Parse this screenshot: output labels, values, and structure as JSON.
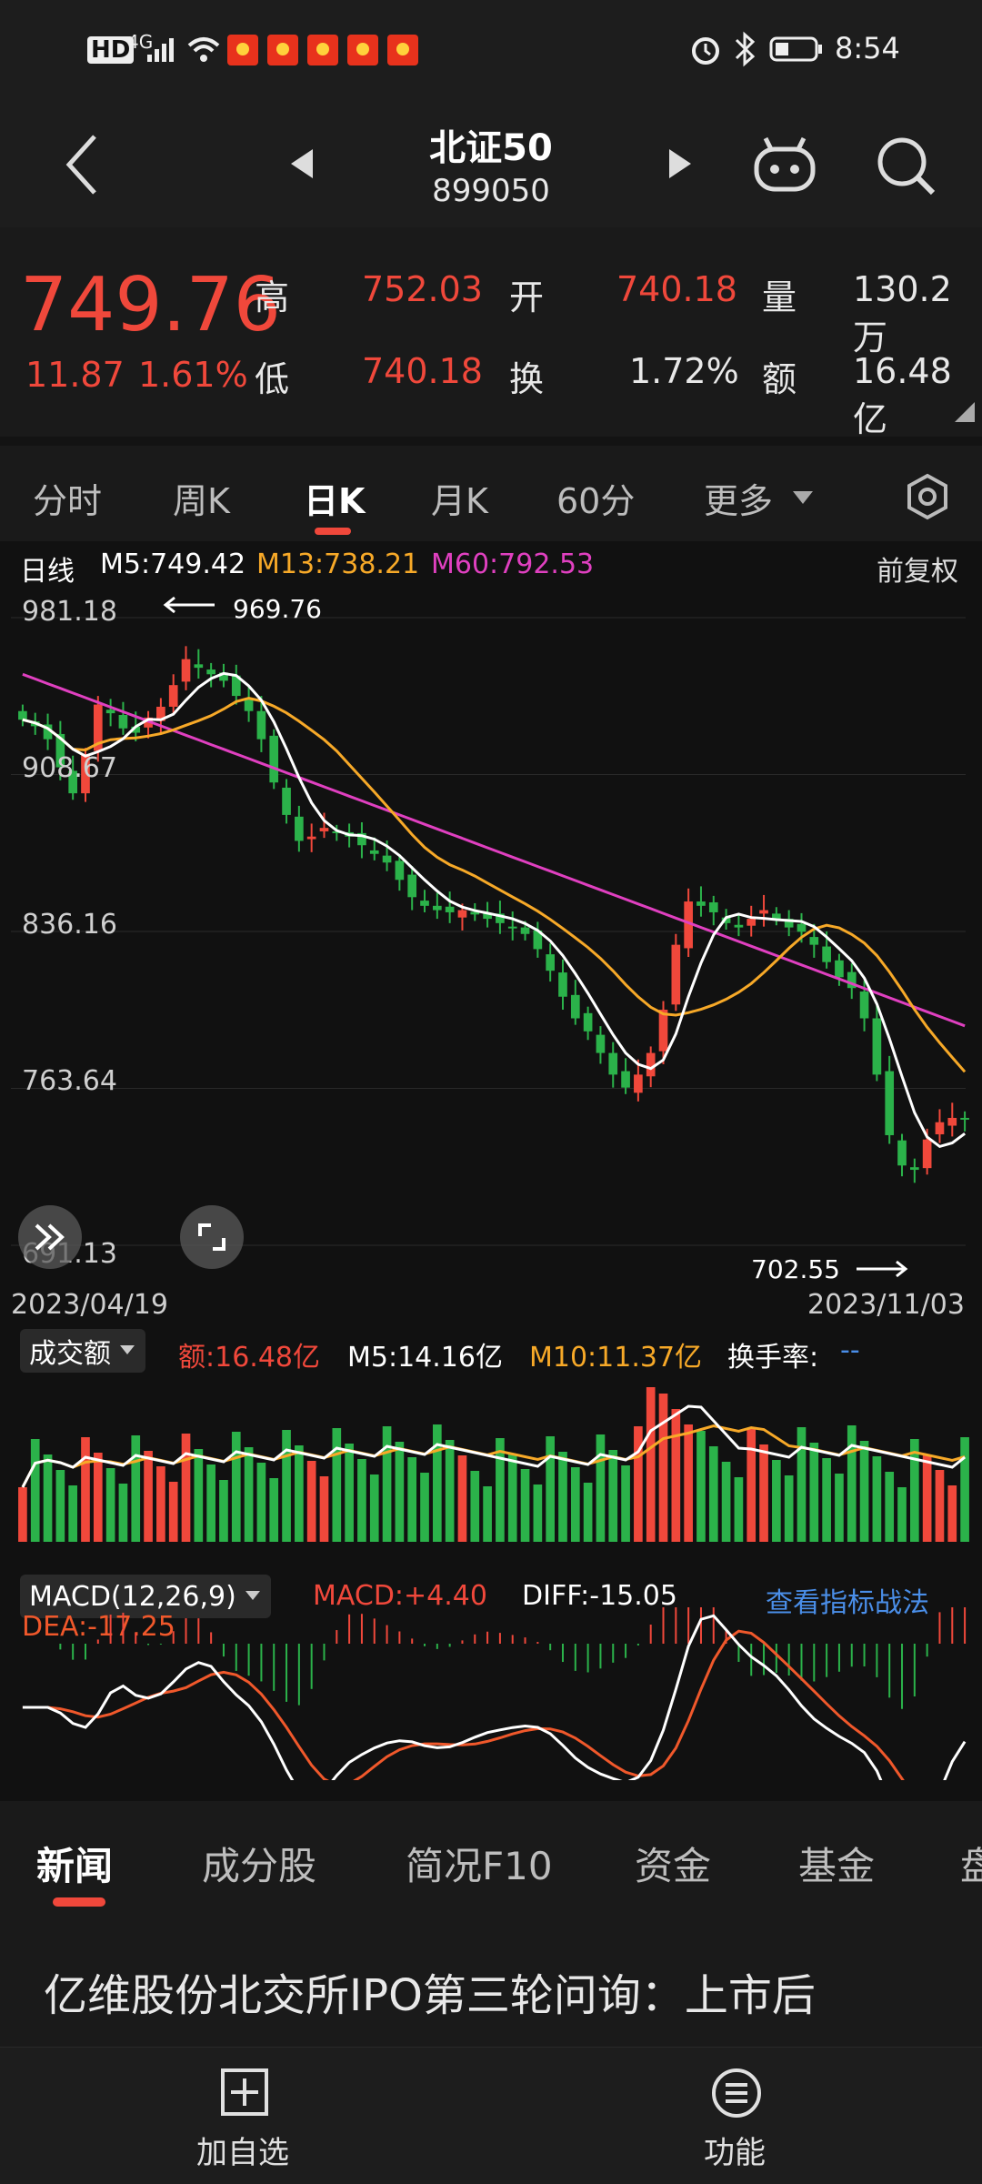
{
  "status_bar": {
    "hd": "HD",
    "net": "4G",
    "time": "8:54",
    "signal_icon": "signal-icon",
    "wifi_icon": "wifi-icon",
    "battery_icon": "battery-icon"
  },
  "header": {
    "title": "北证50",
    "code": "899050"
  },
  "quote": {
    "price": "749.76",
    "change": "11.87",
    "change_pct": "1.61%",
    "high_label": "高",
    "high": "752.03",
    "low_label": "低",
    "low": "740.18",
    "open_label": "开",
    "open": "740.18",
    "turnover_label": "换",
    "turnover": "1.72%",
    "volume_label": "量",
    "volume": "130.2万",
    "amount_label": "额",
    "amount": "16.48亿"
  },
  "period_tabs": [
    "分时",
    "周K",
    "日K",
    "月K",
    "60分",
    "更多"
  ],
  "active_period": "日K",
  "kline": {
    "label": "日线",
    "m5": "M5:749.42",
    "m13": "M13:738.21",
    "m60": "M60:792.53",
    "adjust": "前复权",
    "y_ticks": [
      "981.18",
      "908.67",
      "836.16",
      "763.64",
      "691.13"
    ],
    "max_label": "969.76",
    "min_label": "702.55",
    "date_start": "2023/04/19",
    "date_end": "2023/11/03"
  },
  "volume_panel": {
    "selector": "成交额",
    "amount": "额:16.48亿",
    "m5": "M5:14.16亿",
    "m10": "M10:11.37亿",
    "turnover_rate": "换手率:",
    "turnover_rate_val": "--"
  },
  "macd_panel": {
    "selector": "MACD(12,26,9)",
    "macd": "MACD:+4.40",
    "diff": "DIFF:-15.05",
    "dea": "DEA:-17.25",
    "link": "查看指标战法"
  },
  "chart_data": {
    "type": "candlestick",
    "title": "北证50 日K",
    "date_range": [
      "2023/04/19",
      "2023/11/03"
    ],
    "ylim": [
      691.13,
      981.18
    ],
    "y_ticks": [
      981.18,
      908.67,
      836.16,
      763.64,
      691.13
    ],
    "annotations": {
      "high": 969.76,
      "low": 702.55
    },
    "close_series": [
      934,
      931,
      925,
      912,
      900,
      918,
      941,
      937,
      930,
      928,
      935,
      940,
      950,
      962,
      958,
      955,
      952,
      945,
      938,
      925,
      905,
      890,
      878,
      880,
      884,
      882,
      880,
      876,
      872,
      868,
      860,
      852,
      848,
      846,
      845,
      846,
      844,
      842,
      840,
      838,
      835,
      828,
      818,
      806,
      796,
      790,
      780,
      770,
      764,
      770,
      780,
      800,
      830,
      850,
      848,
      845,
      840,
      838,
      842,
      846,
      842,
      838,
      836,
      830,
      822,
      815,
      810,
      796,
      770,
      742,
      728,
      726,
      740,
      748,
      750,
      749.76
    ],
    "colors": {
      "up": "#f0483b",
      "down": "#2bb24a",
      "m5": "#ffffff",
      "m13": "#f7a928",
      "m60": "#e040c0"
    }
  },
  "news_tabs": [
    "新闻",
    "成分股",
    "简况F10",
    "资金",
    "基金",
    "盘"
  ],
  "active_news_tab": "新闻",
  "article": {
    "headline": "亿维股份北交所IPO第三轮问询：上市后"
  },
  "bottom_bar": {
    "add_label": "加自选",
    "func_label": "功能"
  }
}
